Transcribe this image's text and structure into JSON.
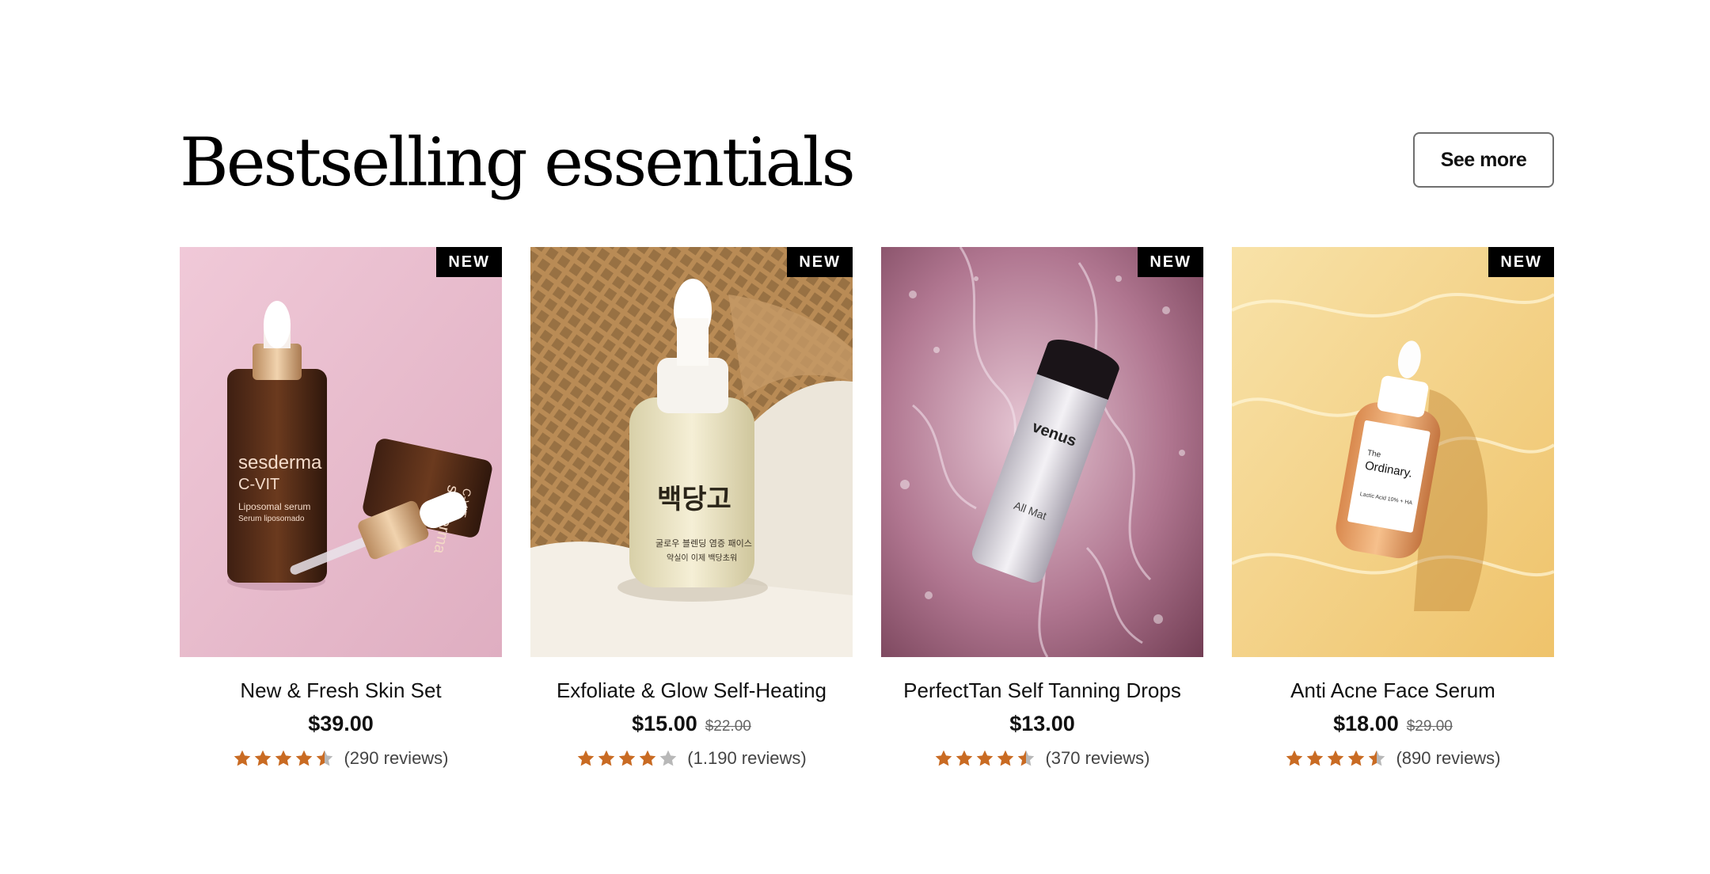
{
  "section": {
    "title": "Bestselling essentials",
    "see_more_label": "See more"
  },
  "colors": {
    "star": "#c96b23",
    "star_empty": "#b8b8b8",
    "badge_bg": "#000000"
  },
  "products": [
    {
      "name": "New & Fresh Skin Set",
      "badge": "NEW",
      "price": "$39.00",
      "old_price": "",
      "rating": 4.5,
      "reviews": "(290 reviews)",
      "image": {
        "brand": "sesderma",
        "line": "C-VIT",
        "sub1": "Liposomal serum",
        "sub2": "Serum liposomado",
        "second_brand": "sesderma",
        "second_line": "C-VIT"
      }
    },
    {
      "name": "Exfoliate & Glow Self-Heating",
      "badge": "NEW",
      "price": "$15.00",
      "old_price": "$22.00",
      "rating": 4,
      "reviews": "(1.190 reviews)",
      "image": {
        "brand": "백당고",
        "sub1": "굴로우 블렌딩 염증 패이스",
        "sub2": "약실이 이제 백당초워"
      }
    },
    {
      "name": "PerfectTan Self Tanning Drops",
      "badge": "NEW",
      "price": "$13.00",
      "old_price": "",
      "rating": 4.5,
      "reviews": "(370 reviews)",
      "image": {
        "brand": "venus",
        "sub1": "All Mat"
      }
    },
    {
      "name": "Anti Acne Face Serum",
      "badge": "NEW",
      "price": "$18.00",
      "old_price": "$29.00",
      "rating": 4.5,
      "reviews": "(890 reviews)",
      "image": {
        "brand_top": "The",
        "brand": "Ordinary.",
        "sub1": "Lactic Acid 10% + HA"
      }
    }
  ]
}
